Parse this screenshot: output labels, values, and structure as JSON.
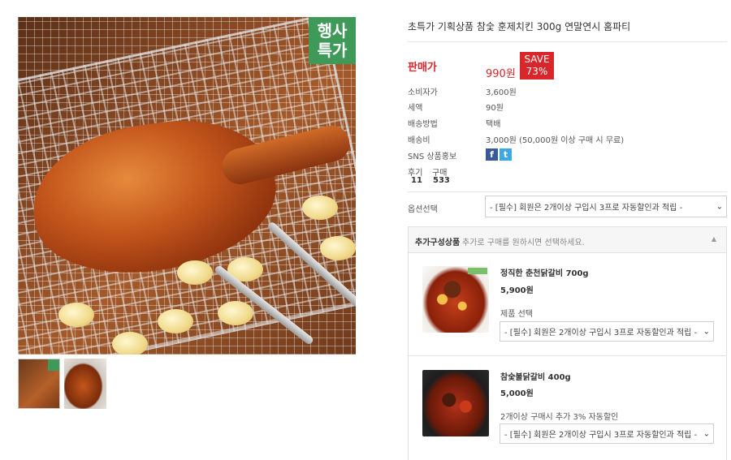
{
  "product": {
    "title": "초특가 기획상품 참숯 훈제치킨 300g 연말연시 홈파티",
    "event_badge_line1": "행사",
    "event_badge_line2": "특가",
    "price_label": "판매가",
    "price": "990원",
    "save_line1": "SAVE",
    "save_line2": "73%",
    "info": [
      {
        "label": "소비자가",
        "value": "3,600원"
      },
      {
        "label": "세액",
        "value": "90원"
      },
      {
        "label": "배송방법",
        "value": "택배"
      },
      {
        "label": "배송비",
        "value": "3,000원 (50,000원 이상 구매 시 무료)"
      },
      {
        "label": "SNS 상품홍보",
        "value": ""
      }
    ],
    "sns": {
      "facebook": "f",
      "twitter": "t"
    },
    "stats": {
      "review_label": "후기",
      "review_count": "11",
      "purchase_label": "구매",
      "purchase_count": "533"
    },
    "option_label": "옵션선택",
    "option_selected": "- [필수] 회원은 2개이상 구입시 3프로 자동할인과 적립 -"
  },
  "addons": {
    "header_title": "추가구성상품",
    "header_sub": "추가로 구매를 원하시면 선택하세요.",
    "items": [
      {
        "name": "정직한 춘천닭갈비 700g",
        "price": "5,900원",
        "note": "제품 선택",
        "select": "- [필수] 회원은 2개이상 구입시 3프로 자동할인과 적립 -"
      },
      {
        "name": "참숯불닭갈비 400g",
        "price": "5,000원",
        "note": "2개이상 구매시 추가 3% 자동할인",
        "select": "- [필수] 회원은 2개이상 구입시 3프로 자동할인과 적립 -"
      }
    ]
  },
  "colors": {
    "accent_red": "#d8262b",
    "event_green": "#3f9a5a",
    "facebook": "#3b5998",
    "twitter": "#3ca9e6"
  }
}
